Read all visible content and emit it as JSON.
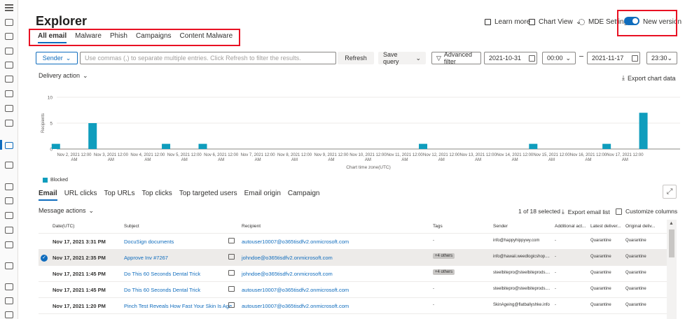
{
  "page": {
    "title": "Explorer",
    "learn_more": "Learn more",
    "chart_view": "Chart View",
    "mde_settings": "MDE Settings",
    "new_version": "New version"
  },
  "top_tabs": [
    "All email",
    "Malware",
    "Phish",
    "Campaigns",
    "Content Malware"
  ],
  "filter": {
    "sender_label": "Sender",
    "search_placeholder": "Use commas (,) to separate multiple entries. Click Refresh to filter the results.",
    "refresh": "Refresh",
    "save_query": "Save query",
    "advanced_filter": "Advanced filter",
    "start_date": "2021-10-31",
    "start_time": "00:00",
    "end_date": "2021-11-17",
    "end_time": "23:30"
  },
  "chart_header": {
    "delivery_action": "Delivery action",
    "export_chart": "Export chart data"
  },
  "chart_data": {
    "type": "bar",
    "ylabel": "Recipients",
    "xlabel": "Chart time zone(UTC)",
    "y_ticks": [
      "10",
      "5",
      "0"
    ],
    "ylim": [
      0,
      10
    ],
    "x_ticks": [
      "Nov 2, 2021 12:00 AM",
      "Nov 3, 2021 12:00 AM",
      "Nov 4, 2021 12:00 AM",
      "Nov 5, 2021 12:00 AM",
      "Nov 6, 2021 12:00 AM",
      "Nov 7, 2021 12:00 AM",
      "Nov 8, 2021 12:00 AM",
      "Nov 9, 2021 12:00 AM",
      "Nov 10, 2021 12:00 AM",
      "Nov 11, 2021 12:00 AM",
      "Nov 12, 2021 12:00 AM",
      "Nov 13, 2021 12:00 AM",
      "Nov 14, 2021 12:00 AM",
      "Nov 15, 2021 12:00 AM",
      "Nov 16, 2021 12:00 AM",
      "Nov 17, 2021 12:00 AM"
    ],
    "series": [
      {
        "name": "Blocked",
        "color": "#0f9dbd",
        "points": [
          {
            "x": "Nov 1, 2021 12:00 PM",
            "y": 1
          },
          {
            "x": "Nov 2, 2021 12:00 PM",
            "y": 5
          },
          {
            "x": "Nov 4, 2021 12:00 PM",
            "y": 1
          },
          {
            "x": "Nov 5, 2021 12:00 PM",
            "y": 1
          },
          {
            "x": "Nov 11, 2021 12:00 PM",
            "y": 1
          },
          {
            "x": "Nov 14, 2021 12:00 PM",
            "y": 1
          },
          {
            "x": "Nov 16, 2021 12:00 PM",
            "y": 1
          },
          {
            "x": "Nov 17, 2021 12:00 PM",
            "y": 7
          }
        ]
      }
    ],
    "legend_position": "bottom-left"
  },
  "lower_tabs": [
    "Email",
    "URL clicks",
    "Top URLs",
    "Top clicks",
    "Top targeted users",
    "Email origin",
    "Campaign"
  ],
  "list_toolbar": {
    "message_actions": "Message actions",
    "selected": "1 of 18 selected",
    "export_list": "Export email list",
    "customize": "Customize columns"
  },
  "columns": [
    "Date(UTC)",
    "Subject",
    "Recipient",
    "Tags",
    "Sender",
    "Additional act...",
    "Latest deliver...",
    "Original deliv..."
  ],
  "rows": [
    {
      "date": "Nov 17, 2021 3:31 PM",
      "subject": "DocuSign documents",
      "recipient": "autouser10007@o365tisdfv2.onmicrosoft.com",
      "tags": "-",
      "sender": "info@happyhippywy.com",
      "additional": "-",
      "latest": "Quarantine",
      "original": "Quarantine",
      "selected": false,
      "pill": false
    },
    {
      "date": "Nov 17, 2021 2:35 PM",
      "subject": "Approve Inv #7267",
      "recipient": "johndoe@o365tisdfv2.onmicrosoft.com",
      "tags": "+4 others",
      "sender": "info@hawaii.weedlogicshop....",
      "additional": "-",
      "latest": "Quarantine",
      "original": "Quarantine",
      "selected": true,
      "pill": true
    },
    {
      "date": "Nov 17, 2021 1:45 PM",
      "subject": "Do This 60 Seconds Dental Trick",
      "recipient": "johndoe@o365tisdfv2.onmicrosoft.com",
      "tags": "+4 others",
      "sender": "steelbitepro@steelbiteprods....",
      "additional": "-",
      "latest": "Quarantine",
      "original": "Quarantine",
      "selected": false,
      "pill": true
    },
    {
      "date": "Nov 17, 2021 1:45 PM",
      "subject": "Do This 60 Seconds Dental Trick",
      "recipient": "autouser10007@o365tisdfv2.onmicrosoft.com",
      "tags": "-",
      "sender": "steelbitepro@steelbiteprods....",
      "additional": "-",
      "latest": "Quarantine",
      "original": "Quarantine",
      "selected": false,
      "pill": false
    },
    {
      "date": "Nov 17, 2021 1:20 PM",
      "subject": "Pinch Test Reveals How Fast Your Skin Is Age",
      "recipient": "autouser10007@o365tisdfv2.onmicrosoft.com",
      "tags": "-",
      "sender": "SkinAgeing@flatballyshke.info",
      "additional": "-",
      "latest": "Quarantine",
      "original": "Quarantine",
      "selected": false,
      "pill": false
    }
  ]
}
